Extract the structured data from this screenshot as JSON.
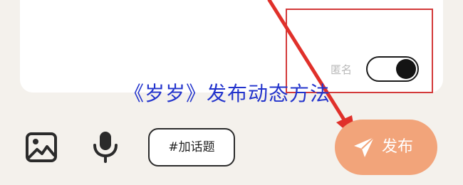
{
  "composer": {
    "anonymous_label": "匿名",
    "anonymous_enabled": true
  },
  "watermark": {
    "text": "《岁岁》发布动态方法"
  },
  "toolbar": {
    "image_icon": "image-icon",
    "mic_icon": "microphone-icon",
    "topic_label": "#加话题",
    "publish_label": "发布",
    "publish_icon": "paper-plane-icon"
  },
  "colors": {
    "publish_button": "#f2a47a",
    "annotation_red": "#d33a3a",
    "watermark_blue": "#2233cc"
  }
}
